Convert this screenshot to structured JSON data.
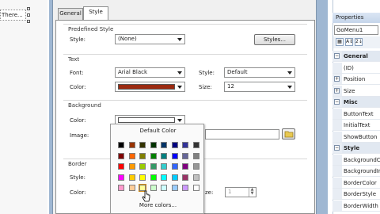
{
  "canvas": {
    "tag_text": "There..."
  },
  "dialog": {
    "tabs": [
      {
        "label": "General"
      },
      {
        "label": "Style"
      }
    ],
    "predefined": {
      "title": "Predefined Style",
      "style_label": "Style:",
      "style_value": "(None)",
      "styles_button": "Styles..."
    },
    "text": {
      "title": "Text",
      "font_label": "Font:",
      "font_value": "Arial Black",
      "style_label": "Style:",
      "style_value": "Default",
      "color_label": "Color:",
      "color_value": "#9b2a10",
      "size_label": "Size:",
      "size_value": "12"
    },
    "background": {
      "title": "Background",
      "color_label": "Color:",
      "image_label": "Image:"
    },
    "border": {
      "title": "Border",
      "style_label": "Style:",
      "color_label": "Color:",
      "size_label": "ze:",
      "size_value": "1"
    }
  },
  "color_popup": {
    "title": "Default Color",
    "more": "More colors...",
    "rows": [
      [
        "#000000",
        "#993300",
        "#333300",
        "#003300",
        "#003366",
        "#000080",
        "#333399",
        "#333333"
      ],
      [
        "#800000",
        "#ff6600",
        "#808000",
        "#008000",
        "#008080",
        "#0000ff",
        "#666699",
        "#808080"
      ],
      [
        "#ff0000",
        "#ff9900",
        "#99cc00",
        "#339966",
        "#33cccc",
        "#3366ff",
        "#800080",
        "#969696"
      ],
      [
        "#ff00ff",
        "#ffcc00",
        "#ffff00",
        "#00ff00",
        "#00ffff",
        "#00ccff",
        "#993366",
        "#c0c0c0"
      ],
      [
        "#ff99cc",
        "#ffcc99",
        "#ffff99",
        "#ccffcc",
        "#ccffff",
        "#99ccff",
        "#cc99ff",
        "#ffffff"
      ]
    ]
  },
  "properties": {
    "title": "Properties",
    "object": "GoMenu1",
    "toolbar": [
      "A↕",
      "2↓"
    ],
    "rows": [
      {
        "kind": "cat",
        "text": "General",
        "sign": "−"
      },
      {
        "kind": "prop",
        "text": "(ID)"
      },
      {
        "kind": "prop",
        "text": "Position",
        "sign": "+"
      },
      {
        "kind": "prop",
        "text": "Size",
        "sign": "+"
      },
      {
        "kind": "cat",
        "text": "Misc",
        "sign": "−"
      },
      {
        "kind": "prop",
        "text": "ButtonText"
      },
      {
        "kind": "prop",
        "text": "InitialText"
      },
      {
        "kind": "prop",
        "text": "ShowButton"
      },
      {
        "kind": "cat",
        "text": "Style",
        "sign": "−"
      },
      {
        "kind": "prop",
        "text": "BackgroundC"
      },
      {
        "kind": "prop",
        "text": "BackgroundIr"
      },
      {
        "kind": "prop",
        "text": "BorderColor"
      },
      {
        "kind": "prop",
        "text": "BorderStyle"
      },
      {
        "kind": "prop",
        "text": "BorderWidth"
      }
    ]
  }
}
